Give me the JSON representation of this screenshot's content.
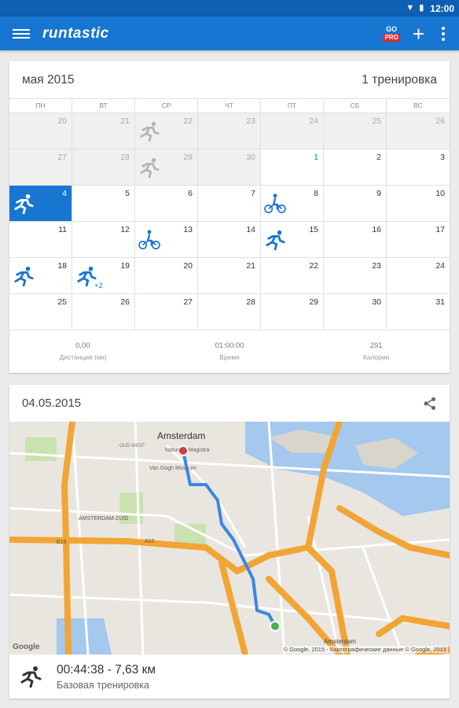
{
  "status_bar": {
    "time": "12:00"
  },
  "app_bar": {
    "logo": "runtastic",
    "go_label": "GO",
    "pro_label": "PRO",
    "add_label": "+"
  },
  "calendar": {
    "month_title": "мая 2015",
    "workout_count": "1 тренировка",
    "weekdays": [
      "ПН",
      "ВТ",
      "СР",
      "ЧТ",
      "ПТ",
      "СБ",
      "ВС"
    ],
    "cells": [
      {
        "n": "20",
        "other": true
      },
      {
        "n": "21",
        "other": true
      },
      {
        "n": "22",
        "other": true,
        "icon": "run-faded"
      },
      {
        "n": "23",
        "other": true
      },
      {
        "n": "24",
        "other": true
      },
      {
        "n": "25",
        "other": true
      },
      {
        "n": "26",
        "other": true
      },
      {
        "n": "27",
        "other": true
      },
      {
        "n": "28",
        "other": true
      },
      {
        "n": "29",
        "other": true,
        "icon": "run-faded"
      },
      {
        "n": "30",
        "other": true
      },
      {
        "n": "1",
        "first": true
      },
      {
        "n": "2"
      },
      {
        "n": "3"
      },
      {
        "n": "4",
        "today": true,
        "icon": "run-white"
      },
      {
        "n": "5"
      },
      {
        "n": "6"
      },
      {
        "n": "7"
      },
      {
        "n": "8",
        "icon": "bike"
      },
      {
        "n": "9"
      },
      {
        "n": "10"
      },
      {
        "n": "11"
      },
      {
        "n": "12"
      },
      {
        "n": "13",
        "icon": "bike"
      },
      {
        "n": "14"
      },
      {
        "n": "15",
        "icon": "run"
      },
      {
        "n": "16"
      },
      {
        "n": "17"
      },
      {
        "n": "18",
        "icon": "run"
      },
      {
        "n": "19",
        "icon": "run",
        "more": "+2"
      },
      {
        "n": "20"
      },
      {
        "n": "21"
      },
      {
        "n": "22"
      },
      {
        "n": "23"
      },
      {
        "n": "24"
      },
      {
        "n": "25"
      },
      {
        "n": "26"
      },
      {
        "n": "27"
      },
      {
        "n": "28"
      },
      {
        "n": "29"
      },
      {
        "n": "30"
      },
      {
        "n": "31"
      }
    ],
    "summary": [
      {
        "value": "0,00",
        "label": "Дистанция (км)"
      },
      {
        "value": "01:00:00",
        "label": "Время"
      },
      {
        "value": "291",
        "label": "Калории"
      }
    ]
  },
  "session": {
    "date": "04.05.2015",
    "map": {
      "city_label": "Amsterdam",
      "label_museum": "Van Gogh Museum",
      "label_national": "Naturalis Magistra",
      "label_zuid": "AMSTERDAM-ZUID",
      "label_a10": "A10",
      "label_e19": "E19",
      "label_oud_west": "OUD-WEST",
      "label_amsterdam2": "Amsterdam",
      "copyright": "© Google, 2015 - Картографические данные © Google, 2015",
      "google_logo": "Google"
    },
    "duration_distance": "00:44:38 - 7,63 км",
    "workout_type": "Базовая тренировка"
  },
  "colors": {
    "primary": "#1776d1",
    "status_bar": "#0d5fb3",
    "route": "#3b86e4",
    "highway": "#f2a535",
    "start": "#4caf50",
    "end": "#e53945"
  }
}
